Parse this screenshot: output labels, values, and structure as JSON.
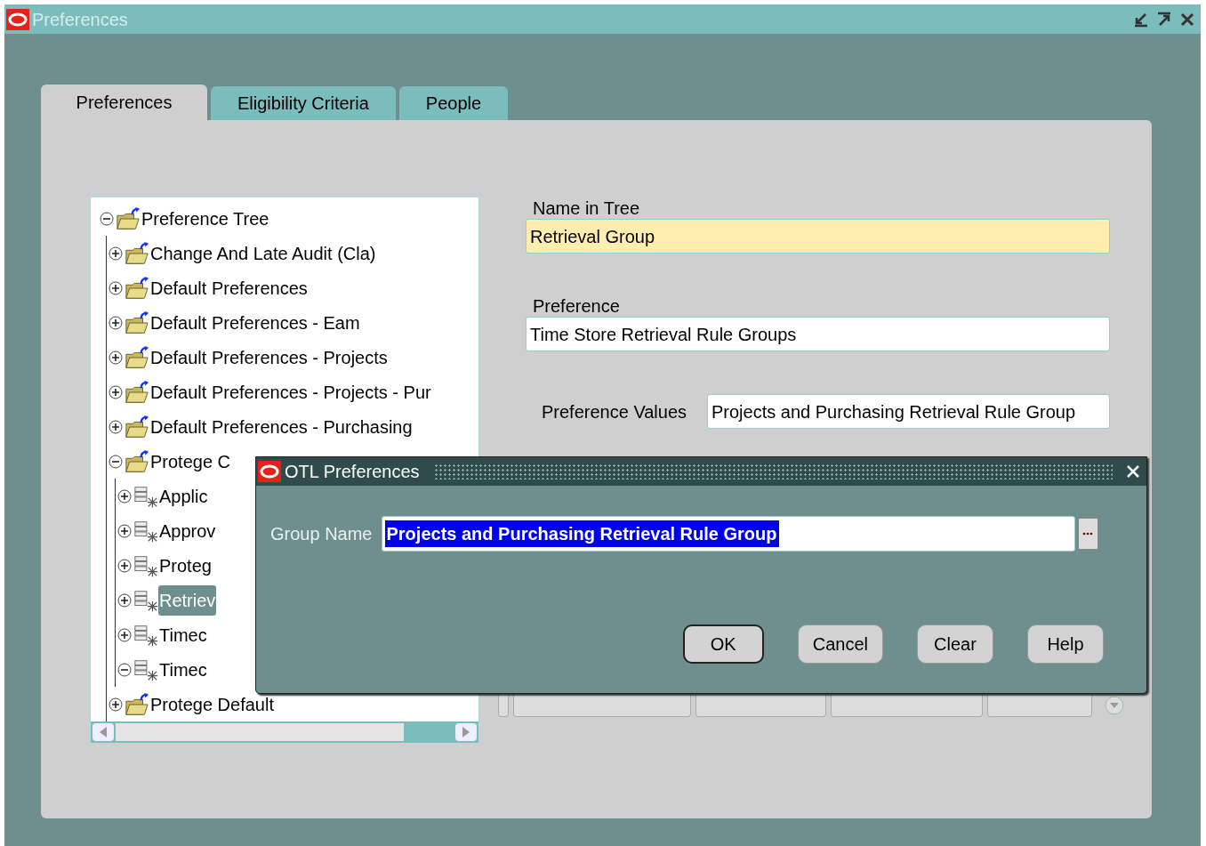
{
  "window": {
    "title": "Preferences"
  },
  "tabs": [
    {
      "label": "Preferences",
      "selected": true
    },
    {
      "label": "Eligibility Criteria",
      "selected": false
    },
    {
      "label": "People",
      "selected": false
    }
  ],
  "tree": {
    "items": [
      {
        "label": "Preference Tree",
        "kind": "folder",
        "expanded": true,
        "selected": false,
        "children": [
          {
            "label": "Change And Late Audit (Cla)",
            "kind": "folder",
            "expanded": false,
            "selected": false
          },
          {
            "label": "Default Preferences",
            "kind": "folder",
            "expanded": false,
            "selected": false
          },
          {
            "label": "Default Preferences - Eam",
            "kind": "folder",
            "expanded": false,
            "selected": false
          },
          {
            "label": "Default Preferences - Projects",
            "kind": "folder",
            "expanded": false,
            "selected": false
          },
          {
            "label": "Default Preferences - Projects - Pur",
            "kind": "folder",
            "expanded": false,
            "selected": false
          },
          {
            "label": "Default Preferences - Purchasing",
            "kind": "folder",
            "expanded": false,
            "selected": false
          },
          {
            "label": "Protege C",
            "kind": "folder",
            "expanded": true,
            "selected": false,
            "children": [
              {
                "label": "Applic",
                "kind": "leaf",
                "expanded": false,
                "selected": false
              },
              {
                "label": "Approv",
                "kind": "leaf",
                "expanded": false,
                "selected": false
              },
              {
                "label": "Proteg",
                "kind": "leaf",
                "expanded": false,
                "selected": false
              },
              {
                "label": "Retriev",
                "kind": "leaf",
                "expanded": false,
                "selected": true
              },
              {
                "label": "Timec",
                "kind": "leaf",
                "expanded": false,
                "selected": false
              },
              {
                "label": "Timec",
                "kind": "leaf",
                "expanded": true,
                "selected": false
              }
            ]
          },
          {
            "label": "Protege Default",
            "kind": "folder",
            "expanded": false,
            "selected": false
          }
        ]
      }
    ]
  },
  "fields": [
    {
      "label": "Name in Tree",
      "value": "Retrieval Group",
      "required": true
    },
    {
      "label": "Preference",
      "value": "Time Store Retrieval Rule Groups",
      "required": false
    }
  ],
  "preference_values": {
    "label": "Preference Values",
    "value": "Projects and Purchasing Retrieval Rule Group"
  },
  "dialog": {
    "title": "OTL Preferences",
    "field": {
      "label": "Group Name",
      "value": "Projects and Purchasing Retrieval Rule Group"
    },
    "buttons": [
      {
        "label": "OK",
        "default": true
      },
      {
        "label": "Cancel",
        "default": false
      },
      {
        "label": "Clear",
        "default": false
      },
      {
        "label": "Help",
        "default": false
      }
    ]
  }
}
